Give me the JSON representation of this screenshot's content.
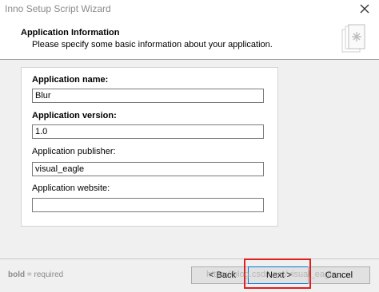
{
  "window": {
    "title": "Inno Setup Script Wizard"
  },
  "header": {
    "title": "Application Information",
    "subtitle": "Please specify some basic information about your application."
  },
  "form": {
    "name_label": "Application name:",
    "name_value": "Blur",
    "version_label": "Application version:",
    "version_value": "1.0",
    "publisher_label": "Application publisher:",
    "publisher_value": "visual_eagle",
    "website_label": "Application website:",
    "website_value": ""
  },
  "footer": {
    "legend_bold": "bold",
    "legend_rest": " = required",
    "back_label": "< Back",
    "next_label": "Next >",
    "cancel_label": "Cancel"
  },
  "watermark": "https://blog.csdn.net/visual_eagle",
  "colors": {
    "highlight": "#e02020",
    "focus": "#0078d7"
  }
}
